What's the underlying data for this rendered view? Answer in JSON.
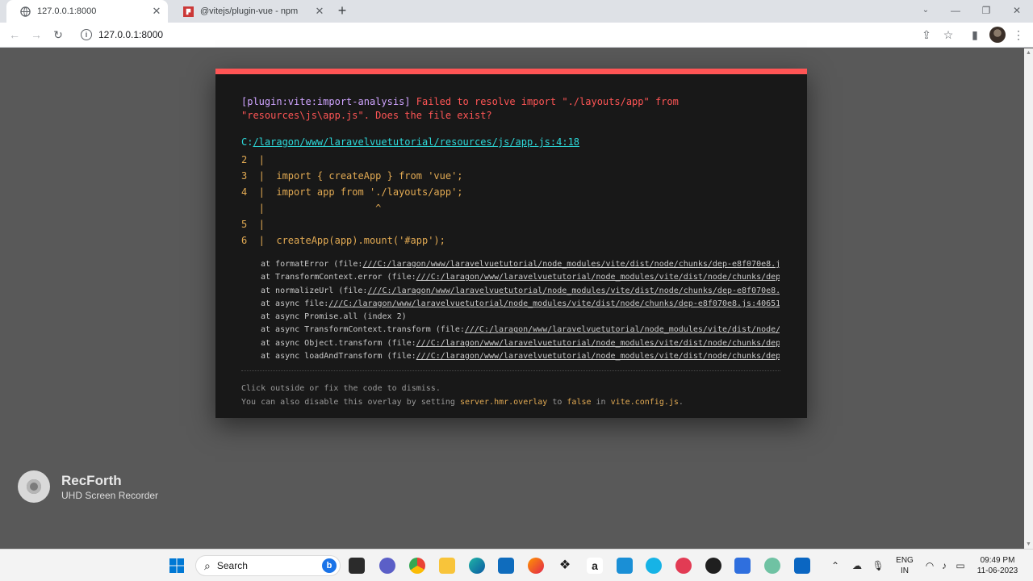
{
  "browser": {
    "tabs": [
      {
        "title": "127.0.0.1:8000",
        "active": true,
        "icon": "globe-icon"
      },
      {
        "title": "@vitejs/plugin-vue - npm",
        "active": false,
        "icon": "npm-icon"
      }
    ],
    "url": "127.0.0.1:8000"
  },
  "overlay": {
    "plugin": "[plugin:vite:import-analysis]",
    "message": " Failed to resolve import \"./layouts/app\" from \"resources\\js\\app.js\". Does the file exist?",
    "file_prefix": "C:",
    "file_link": "/laragon/www/laravelvuetutorial/resources/js/app.js:4:18",
    "frame": "2  |\n3  |  import { createApp } from 'vue';\n4  |  import app from './layouts/app';\n   |                   ^\n5  |\n6  |  createApp(app).mount('#app');",
    "stack": [
      {
        "pre": "at formatError (file:",
        "link": "///C:/laragon/www/laravelvuetutorial/node_modules/vite/dist/node/chunks/dep-e8f070e8.js"
      },
      {
        "pre": "at TransformContext.error (file:",
        "link": "///C:/laragon/www/laravelvuetutorial/node_modules/vite/dist/node/chunks/dep-"
      },
      {
        "pre": "at normalizeUrl (file:",
        "link": "///C:/laragon/www/laravelvuetutorial/node_modules/vite/dist/node/chunks/dep-e8f070e8.j"
      },
      {
        "pre": "at async file:",
        "link": "///C:/laragon/www/laravelvuetutorial/node_modules/vite/dist/node/chunks/dep-e8f070e8.js:40651:"
      },
      {
        "pre": "at async Promise.all (index 2)",
        "link": ""
      },
      {
        "pre": "at async TransformContext.transform (file:",
        "link": "///C:/laragon/www/laravelvuetutorial/node_modules/vite/dist/node/c"
      },
      {
        "pre": "at async Object.transform (file:",
        "link": "///C:/laragon/www/laravelvuetutorial/node_modules/vite/dist/node/chunks/dep-"
      },
      {
        "pre": "at async loadAndTransform (file:",
        "link": "///C:/laragon/www/laravelvuetutorial/node_modules/vite/dist/node/chunks/dep-"
      }
    ],
    "tip_line1": "Click outside or fix the code to dismiss.",
    "tip_line2_a": "You can also disable this overlay by setting ",
    "tip_line2_code1": "server.hmr.overlay",
    "tip_line2_b": " to ",
    "tip_line2_code2": "false",
    "tip_line2_c": " in ",
    "tip_line2_code3": "vite.config.js",
    "tip_line2_d": ".",
    "colors": {
      "accent": "#ff5555",
      "plugin": "#cfa4ff",
      "file": "#2dd9da",
      "code": "#e2aa53",
      "background": "#181818"
    }
  },
  "watermark": {
    "title": "RecForth",
    "subtitle": "UHD Screen Recorder"
  },
  "taskbar": {
    "search_placeholder": "Search",
    "language": "ENG",
    "region": "IN",
    "time": "09:49 PM",
    "date": "11-06-2023"
  }
}
